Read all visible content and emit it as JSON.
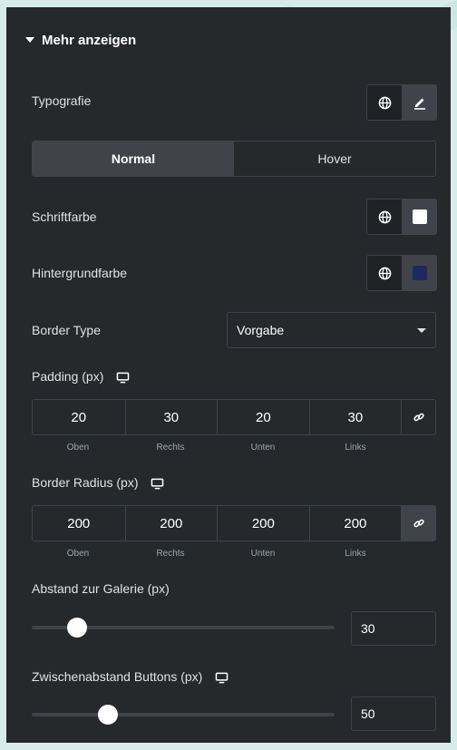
{
  "section": {
    "title": "Mehr anzeigen"
  },
  "typography": {
    "label": "Typografie"
  },
  "tabs": [
    {
      "label": "Normal",
      "active": true
    },
    {
      "label": "Hover",
      "active": false
    }
  ],
  "text_color": {
    "label": "Schriftfarbe",
    "swatch": "#ffffff"
  },
  "bg_color": {
    "label": "Hintergrundfarbe",
    "swatch": "#1d2a5c"
  },
  "border_type": {
    "label": "Border Type",
    "value": "Vorgabe"
  },
  "padding": {
    "label": "Padding (px)",
    "values": [
      "20",
      "30",
      "20",
      "30"
    ],
    "sides": [
      "Oben",
      "Rechts",
      "Unten",
      "Links"
    ],
    "linked": false
  },
  "border_radius": {
    "label": "Border Radius (px)",
    "values": [
      "200",
      "200",
      "200",
      "200"
    ],
    "sides": [
      "Oben",
      "Rechts",
      "Unten",
      "Links"
    ],
    "linked": true
  },
  "gallery_gap": {
    "label": "Abstand zur Galerie (px)",
    "value": "30",
    "slider_fraction": 0.15
  },
  "button_gap": {
    "label": "Zwischenabstand Buttons (px)",
    "value": "50",
    "slider_fraction": 0.25
  },
  "icons": {
    "globe": "globe-icon",
    "pencil": "pencil-icon",
    "monitor": "monitor-icon",
    "link": "link-icon"
  }
}
